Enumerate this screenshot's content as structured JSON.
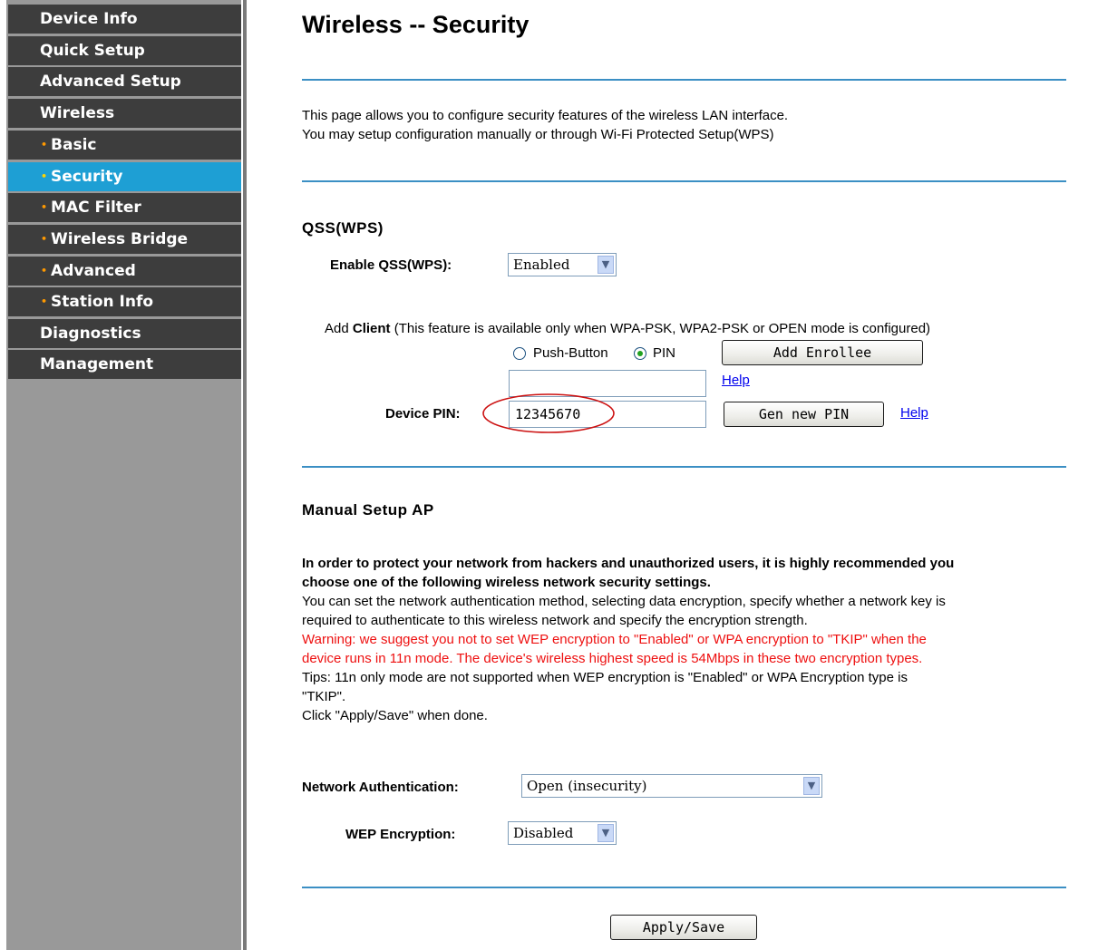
{
  "sidebar": {
    "items": [
      {
        "label": "Device Info"
      },
      {
        "label": "Quick Setup"
      },
      {
        "label": "Advanced Setup"
      },
      {
        "label": "Wireless"
      },
      {
        "label": "Basic"
      },
      {
        "label": "Security"
      },
      {
        "label": "MAC Filter"
      },
      {
        "label": "Wireless Bridge"
      },
      {
        "label": "Advanced"
      },
      {
        "label": "Station Info"
      },
      {
        "label": "Diagnostics"
      },
      {
        "label": "Management"
      }
    ],
    "bullet": "•"
  },
  "page": {
    "title": "Wireless -- Security",
    "intro_line1": "This page allows you to configure security features of the wireless LAN interface.",
    "intro_line2": "You may setup configuration manually or through Wi-Fi Protected Setup(WPS)"
  },
  "qss": {
    "heading": "QSS(WPS)",
    "enable_label": "Enable QSS(WPS):",
    "enable_value": "Enabled",
    "add_client_bold": "Client",
    "add_client_prefix": "Add ",
    "add_client_suffix": " (This feature is available only when WPA-PSK, WPA2-PSK or OPEN mode is configured)",
    "radio_push_label": "Push-Button",
    "radio_pin_label": "PIN",
    "add_enrollee_label": "Add Enrollee",
    "enrollee_pin_value": "",
    "help_label": "Help",
    "device_pin_label": "Device PIN:",
    "device_pin_value": "12345670",
    "gen_pin_label": "Gen new PIN",
    "help2_label": "Help"
  },
  "manual": {
    "heading": "Manual Setup AP",
    "bold_line1": "In order to protect your network from hackers and unauthorized users, it is highly recommended you",
    "bold_line2": "choose one of the following wireless network security settings.",
    "line3": "You can set the network authentication method, selecting data encryption, specify whether a network key is",
    "line4": "required to authenticate to this wireless network and specify the encryption strength.",
    "warn1": "Warning: we suggest you not to set WEP encryption to \"Enabled\" or WPA encryption to \"TKIP\" when the",
    "warn2": "device runs in 11n mode. The device's wireless highest speed is 54Mbps in these two encryption types.",
    "tips1": "Tips: 11n only mode are not supported when WEP encryption is \"Enabled\" or WPA Encryption type is",
    "tips2": "\"TKIP\".",
    "click_line": "Click \"Apply/Save\" when done.",
    "auth_label": "Network Authentication:",
    "auth_value": "Open (insecurity)",
    "wep_label": "WEP Encryption:",
    "wep_value": "Disabled",
    "apply_label": "Apply/Save"
  },
  "colors": {
    "sidebar_item": "#3d3d3d",
    "sidebar_active": "#1e9fd4",
    "divider": "#3b8fc4",
    "warning": "#ee1010",
    "annotation_circle": "#cc1111"
  },
  "icons": {
    "dropdown": "chevron-down-icon",
    "annotation": "red-ellipse-highlight"
  }
}
